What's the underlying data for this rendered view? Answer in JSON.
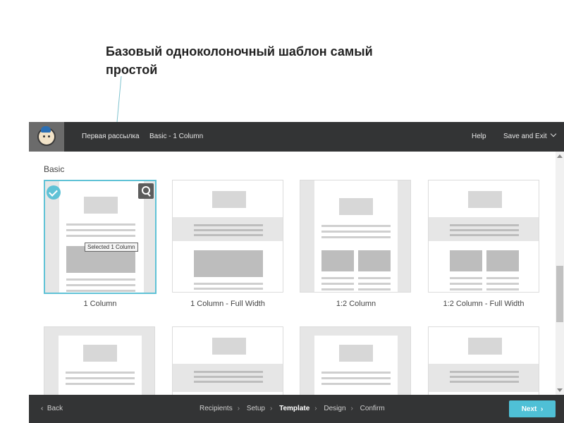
{
  "annotation": {
    "text": "Базовый одноколоночный шаблон самый простой"
  },
  "topbar": {
    "breadcrumb_campaign": "Первая рассылка",
    "breadcrumb_template": "Basic - 1 Column",
    "help": "Help",
    "save_exit": "Save and Exit"
  },
  "section": {
    "title": "Basic"
  },
  "templates": [
    {
      "label": "1 Column",
      "selected": true
    },
    {
      "label": "1 Column - Full Width"
    },
    {
      "label": "1:2 Column"
    },
    {
      "label": "1:2 Column - Full Width"
    }
  ],
  "tooltip": "Selected 1 Column",
  "bottombar": {
    "back": "Back",
    "steps": [
      "Recipients",
      "Setup",
      "Template",
      "Design",
      "Confirm"
    ],
    "active_step": "Template",
    "next": "Next"
  },
  "colors": {
    "accent": "#4fc0d6",
    "bar": "#333435"
  }
}
